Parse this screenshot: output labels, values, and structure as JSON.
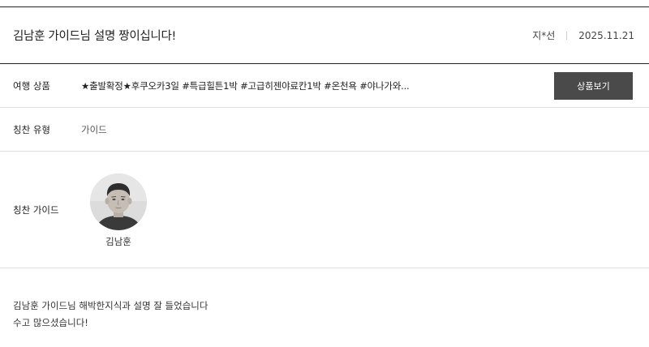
{
  "header": {
    "title": "김남훈 가이드님 설명 짱이십니다!",
    "author": "지*선",
    "date": "2025.11.21"
  },
  "product": {
    "label": "여행 상품",
    "title": "★출발확정★후쿠오카3일 #특급힐튼1박 #고급히젠야료칸1박 #온천욕 #야나가와...",
    "button_label": "상품보기"
  },
  "praise_type": {
    "label": "칭찬 유형",
    "value": "가이드"
  },
  "praise_guide": {
    "label": "칭찬 가이드",
    "name": "김남훈"
  },
  "review": {
    "lines": [
      "김남훈 가이드님 해박한지식과 설명 잘 들었습니다",
      "수고 많으셨습니다!"
    ]
  }
}
